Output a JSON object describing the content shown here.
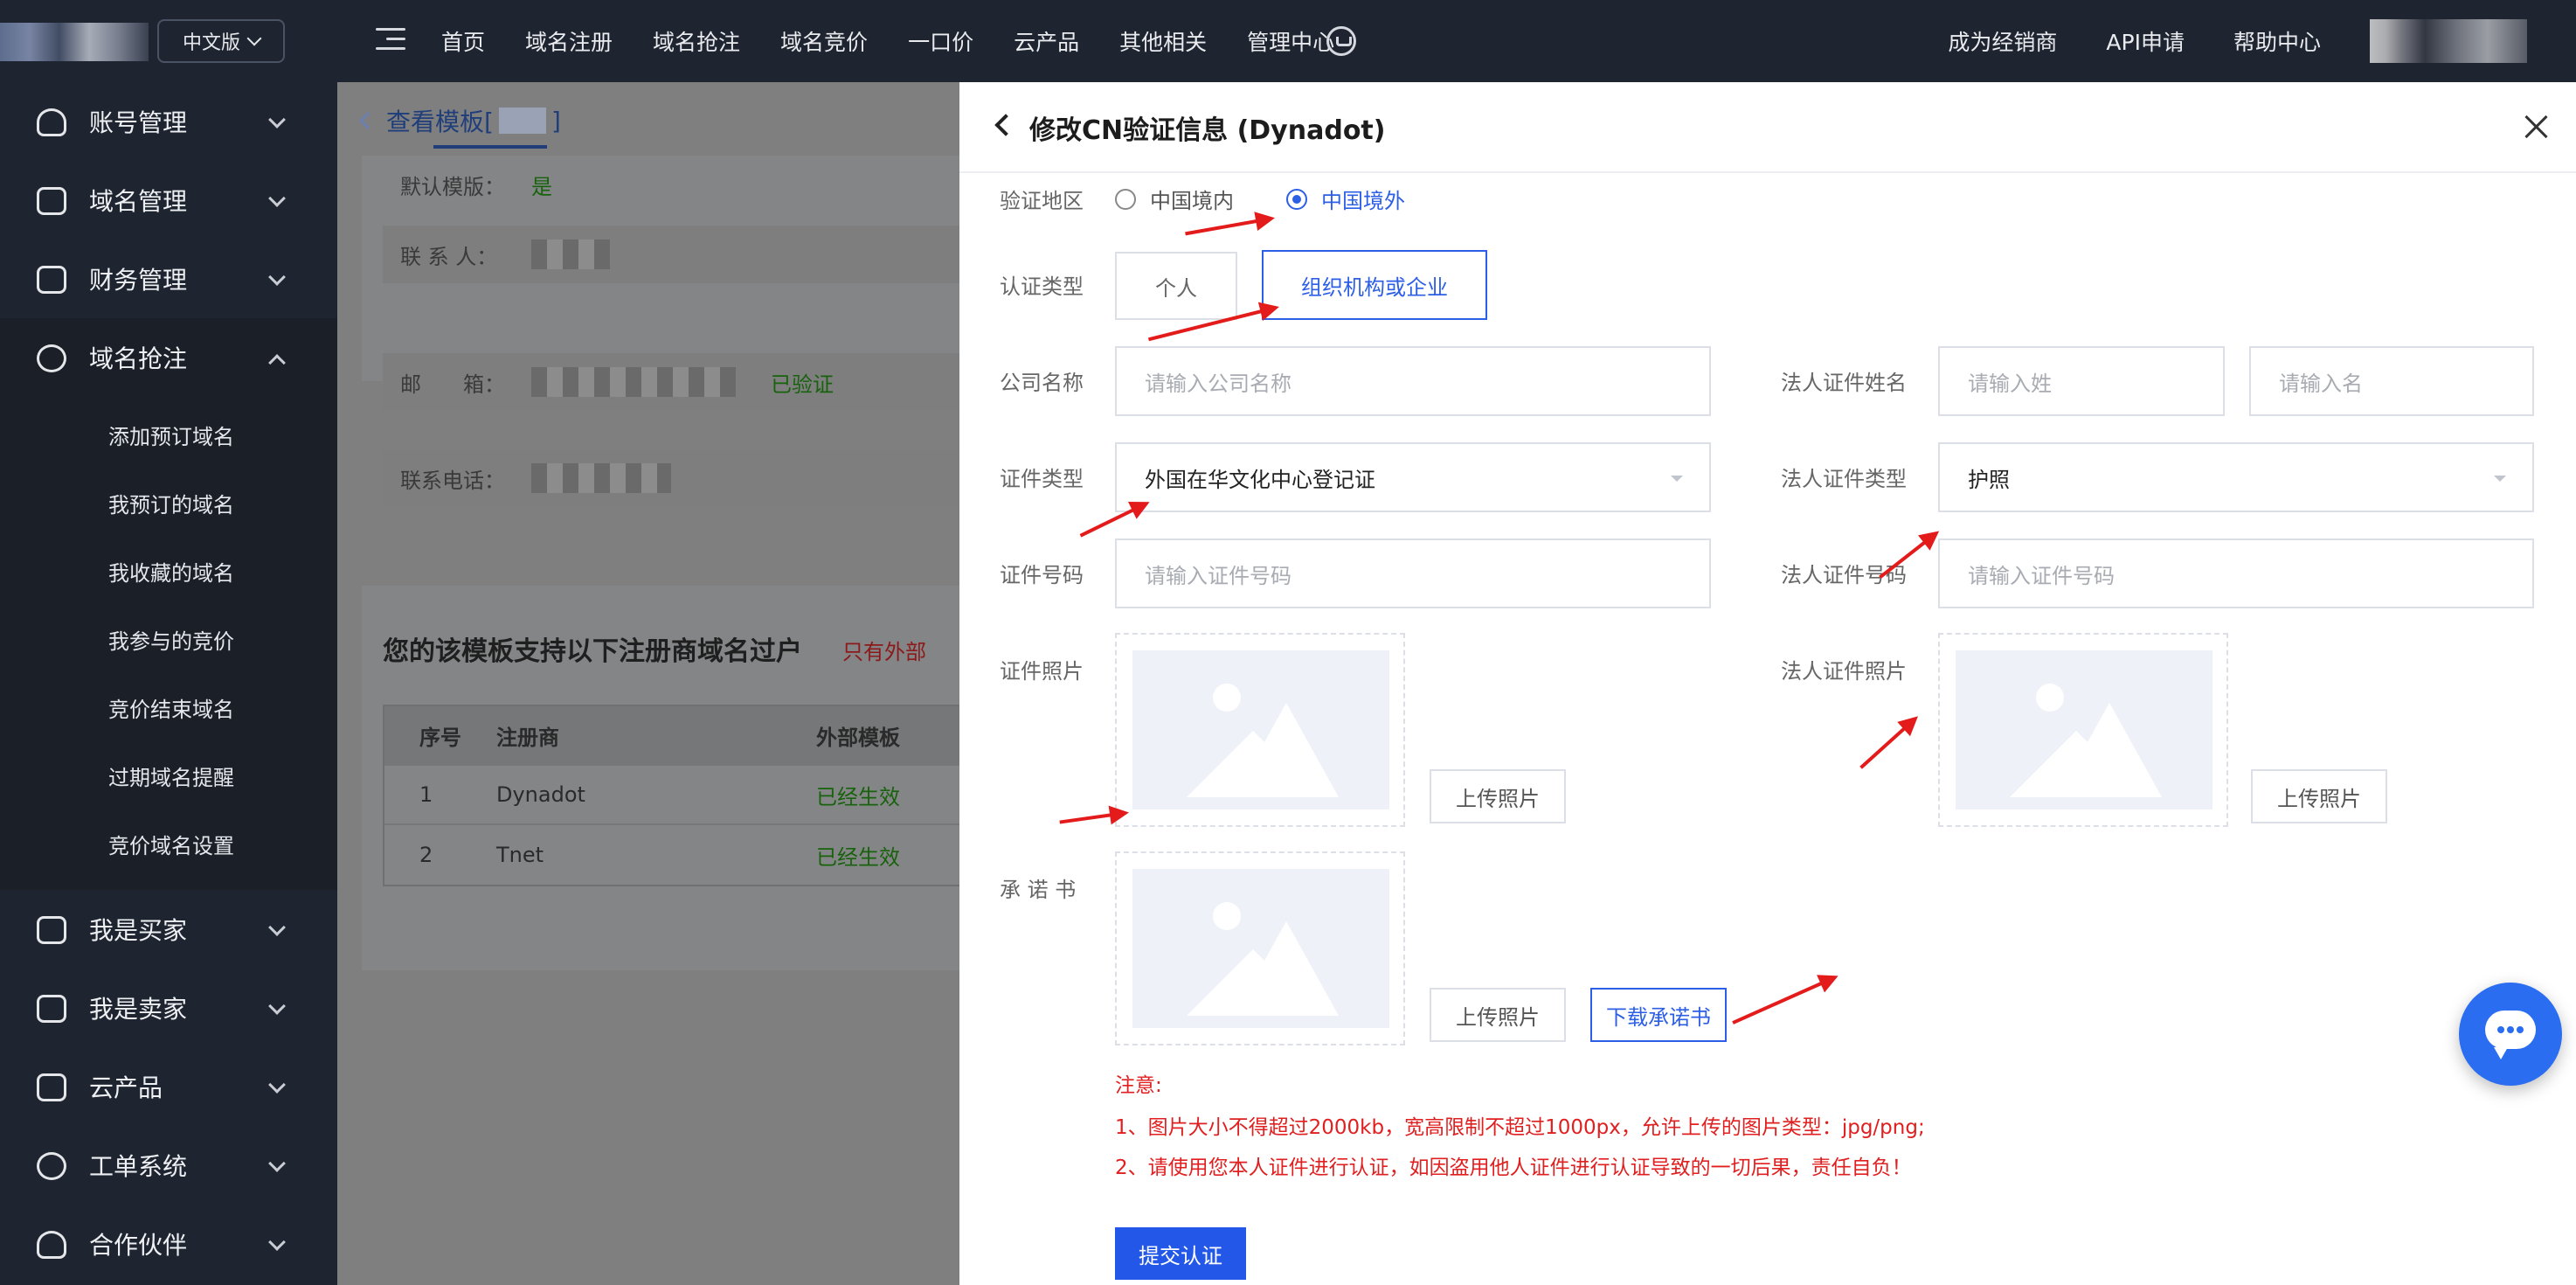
{
  "topbar": {
    "lang_label": "中文版",
    "nav": [
      "首页",
      "域名注册",
      "域名抢注",
      "域名竞价",
      "一口价",
      "云产品",
      "其他相关",
      "管理中心"
    ],
    "right_nav": [
      "成为经销商",
      "API申请",
      "帮助中心"
    ]
  },
  "sidebar": {
    "items": [
      {
        "label": "账号管理",
        "icon": "user-icon"
      },
      {
        "label": "域名管理",
        "icon": "layers-icon"
      },
      {
        "label": "财务管理",
        "icon": "finance-icon"
      },
      {
        "label": "域名抢注",
        "icon": "clock-icon"
      }
    ],
    "sub_items": [
      "添加预订域名",
      "我预订的域名",
      "我收藏的域名",
      "我参与的竞价",
      "竞价结束域名",
      "过期域名提醒",
      "竞价域名设置"
    ],
    "items_after": [
      {
        "label": "我是买家",
        "icon": "cart-icon"
      },
      {
        "label": "我是卖家",
        "icon": "shop-icon"
      },
      {
        "label": "云产品",
        "icon": "cloud-icon"
      },
      {
        "label": "工单系统",
        "icon": "help-icon"
      },
      {
        "label": "合作伙伴",
        "icon": "partner-icon"
      }
    ]
  },
  "background_page": {
    "breadcrumb_label": "查看模板[",
    "breadcrumb_end": "]",
    "default_template_label": "默认模版：",
    "default_template_value": "是",
    "contact_label": "联 系 人：",
    "email_label": "邮　　箱：",
    "email_status": "已验证",
    "phone_label": "联系电话：",
    "section_title": "您的该模板支持以下注册商域名过户",
    "section_note": "只有外部",
    "table_headers": [
      "序号",
      "注册商",
      "外部模板"
    ],
    "table_rows": [
      {
        "no": "1",
        "registrar": "Dynadot",
        "status": "已经生效"
      },
      {
        "no": "2",
        "registrar": "Tnet",
        "status": "已经生效"
      }
    ]
  },
  "drawer": {
    "title": "修改CN验证信息 (Dynadot)",
    "region_label": "验证地区",
    "region_options": [
      "中国境内",
      "中国境外"
    ],
    "auth_type_label": "认证类型",
    "auth_types": [
      "个人",
      "组织机构或企业"
    ],
    "company_name_label": "公司名称",
    "company_name_placeholder": "请输入公司名称",
    "legal_name_label": "法人证件姓名",
    "surname_placeholder": "请输入姓",
    "given_name_placeholder": "请输入名",
    "cert_type_label": "证件类型",
    "cert_type_value": "外国在华文化中心登记证",
    "legal_cert_type_label": "法人证件类型",
    "legal_cert_type_value": "护照",
    "cert_no_label": "证件号码",
    "cert_no_placeholder": "请输入证件号码",
    "legal_cert_no_label": "法人证件号码",
    "legal_cert_no_placeholder": "请输入证件号码",
    "cert_photo_label": "证件照片",
    "legal_cert_photo_label": "法人证件照片",
    "upload_label": "上传照片",
    "commitment_label": "承 诺 书",
    "download_label": "下载承诺书",
    "notice_title": "注意:",
    "notice_1": "1、图片大小不得超过2000kb，宽高限制不超过1000px，允许上传的图片类型：jpg/png;",
    "notice_2": "2、请使用您本人证件进行认证，如因盗用他人证件进行认证导致的一切后果，责任自负！",
    "submit_label": "提交认证"
  },
  "colors": {
    "accent": "#2d5fe6",
    "notice_red": "#e02020",
    "sidebar_bg": "#1f2530"
  }
}
